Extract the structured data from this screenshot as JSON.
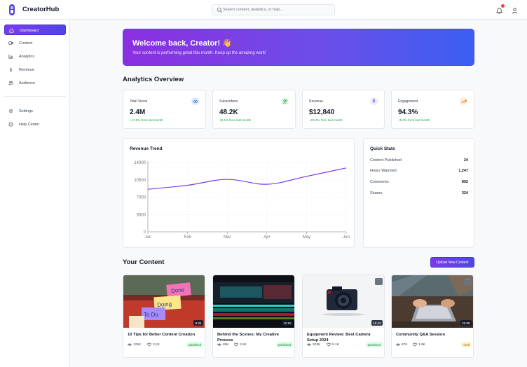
{
  "app": {
    "brand": "CreatorHub",
    "search_placeholder": "Search content, analytics, or help...",
    "accent": "#7c3aed"
  },
  "sidebar": {
    "items": [
      {
        "label": "Dashboard",
        "icon": "home-icon",
        "active": true
      },
      {
        "label": "Content",
        "icon": "video-icon"
      },
      {
        "label": "Analytics",
        "icon": "bar-chart-icon"
      },
      {
        "label": "Revenue",
        "icon": "dollar-icon"
      },
      {
        "label": "Audience",
        "icon": "users-icon"
      },
      {
        "label": "Settings",
        "icon": "gear-icon"
      },
      {
        "label": "Help Center",
        "icon": "help-icon"
      }
    ]
  },
  "welcome": {
    "title": "Welcome back, Creator! 👋",
    "subtitle": "Your content is performing great this month. Keep up the amazing work!"
  },
  "analytics": {
    "title": "Analytics Overview",
    "stats": [
      {
        "label": "Total Views",
        "value": "2.4M",
        "change": "+12.5% from last month",
        "icon": "eye-icon",
        "color": "#3b82f6",
        "bg": "#dbeafe"
      },
      {
        "label": "Subscribers",
        "value": "48.2K",
        "change": "+8.1% from last month",
        "icon": "users-icon",
        "color": "#16a34a",
        "bg": "#dcfce7"
      },
      {
        "label": "Revenue",
        "value": "$12,840",
        "change": "+23.4% from last month",
        "icon": "dollar-icon",
        "color": "#7c3aed",
        "bg": "#ede9fe"
      },
      {
        "label": "Engagement",
        "value": "94.3%",
        "change": "+5.2% from last month",
        "icon": "trend-up-icon",
        "color": "#ea580c",
        "bg": "#ffedd5"
      }
    ]
  },
  "revenue_trend": {
    "title": "Revenue Trend"
  },
  "chart_data": {
    "type": "line",
    "title": "Revenue Trend",
    "categories": [
      "Jan",
      "Feb",
      "Mar",
      "Apr",
      "May",
      "Jun"
    ],
    "values": [
      8600,
      9400,
      10600,
      9600,
      11200,
      12900
    ],
    "yticks": [
      0,
      3500,
      7000,
      10500,
      14000
    ],
    "ylim": [
      0,
      14000
    ],
    "grid": true,
    "color": "#7c3aed"
  },
  "quick_stats": {
    "title": "Quick Stats",
    "rows": [
      {
        "label": "Content Published",
        "value": "24"
      },
      {
        "label": "Hours Watched",
        "value": "1,247"
      },
      {
        "label": "Comments",
        "value": "892"
      },
      {
        "label": "Shares",
        "value": "324"
      }
    ]
  },
  "content": {
    "title": "Your Content",
    "upload_label": "Upload New Content",
    "items": [
      {
        "title": "10 Tips for Better Content Creation",
        "views": "125K",
        "likes": "3.2K",
        "status": "published",
        "duration": "8:34",
        "thumb": "sticky-notes"
      },
      {
        "title": "Behind the Scenes: My Creative Process",
        "views": "89K",
        "likes": "2.6K",
        "status": "published",
        "duration": "12:15",
        "thumb": "editing-screen"
      },
      {
        "title": "Equipment Review: Best Camera Setup 2024",
        "views": "203K",
        "likes": "5.1K",
        "status": "published",
        "duration": "15:42",
        "thumb": "camera"
      },
      {
        "title": "Community Q&A Session",
        "views": "67K",
        "likes": "1.9K",
        "status": "draft",
        "duration": "22:08",
        "thumb": "laptop-hands"
      }
    ],
    "more_glyph": "···"
  }
}
